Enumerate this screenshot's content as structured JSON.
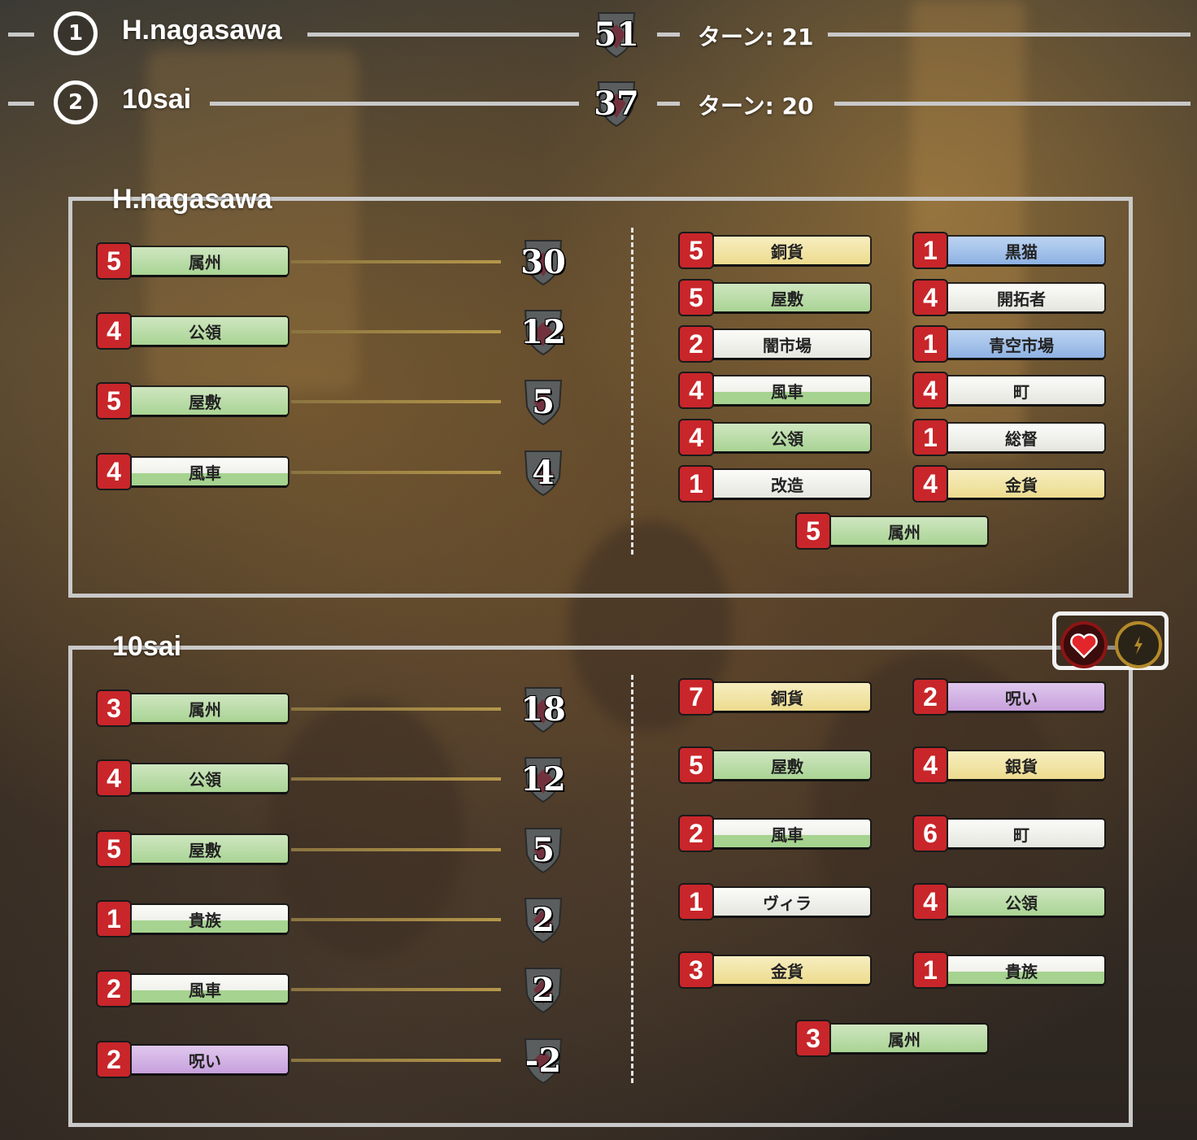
{
  "players": [
    {
      "rank": "1",
      "name": "H.nagasawa",
      "score": "51",
      "turn_label": "ターン: 21"
    },
    {
      "rank": "2",
      "name": "10sai",
      "score": "37",
      "turn_label": "ターン: 20"
    }
  ],
  "panels": [
    {
      "title": "H.nagasawa",
      "scoring": [
        {
          "count": "5",
          "label": "属州",
          "color": "green",
          "points": "30"
        },
        {
          "count": "4",
          "label": "公領",
          "color": "green",
          "points": "12"
        },
        {
          "count": "5",
          "label": "屋敷",
          "color": "green",
          "points": "5"
        },
        {
          "count": "4",
          "label": "風車",
          "color": "white-green",
          "points": "4"
        }
      ],
      "deck": [
        {
          "count": "5",
          "label": "銅貨",
          "color": "yellow"
        },
        {
          "count": "1",
          "label": "黒猫",
          "color": "blue"
        },
        {
          "count": "5",
          "label": "屋敷",
          "color": "green"
        },
        {
          "count": "4",
          "label": "開拓者",
          "color": "white"
        },
        {
          "count": "2",
          "label": "闇市場",
          "color": "white"
        },
        {
          "count": "1",
          "label": "青空市場",
          "color": "blue"
        },
        {
          "count": "4",
          "label": "風車",
          "color": "white-green"
        },
        {
          "count": "4",
          "label": "町",
          "color": "white"
        },
        {
          "count": "4",
          "label": "公領",
          "color": "green"
        },
        {
          "count": "1",
          "label": "総督",
          "color": "white"
        },
        {
          "count": "1",
          "label": "改造",
          "color": "white"
        },
        {
          "count": "4",
          "label": "金貨",
          "color": "yellow"
        },
        {
          "count": "5",
          "label": "属州",
          "color": "green"
        }
      ]
    },
    {
      "title": "10sai",
      "scoring": [
        {
          "count": "3",
          "label": "属州",
          "color": "green",
          "points": "18"
        },
        {
          "count": "4",
          "label": "公領",
          "color": "green",
          "points": "12"
        },
        {
          "count": "5",
          "label": "屋敷",
          "color": "green",
          "points": "5"
        },
        {
          "count": "1",
          "label": "貴族",
          "color": "white-green",
          "points": "2"
        },
        {
          "count": "2",
          "label": "風車",
          "color": "white-green",
          "points": "2"
        },
        {
          "count": "2",
          "label": "呪い",
          "color": "purple",
          "points": "-2"
        }
      ],
      "deck": [
        {
          "count": "7",
          "label": "銅貨",
          "color": "yellow"
        },
        {
          "count": "2",
          "label": "呪い",
          "color": "purple"
        },
        {
          "count": "5",
          "label": "屋敷",
          "color": "green"
        },
        {
          "count": "4",
          "label": "銀貨",
          "color": "yellow"
        },
        {
          "count": "2",
          "label": "風車",
          "color": "white-green"
        },
        {
          "count": "6",
          "label": "町",
          "color": "white"
        },
        {
          "count": "1",
          "label": "ヴィラ",
          "color": "white"
        },
        {
          "count": "4",
          "label": "公領",
          "color": "green"
        },
        {
          "count": "3",
          "label": "金貨",
          "color": "yellow"
        },
        {
          "count": "1",
          "label": "貴族",
          "color": "white-green"
        },
        {
          "count": "3",
          "label": "属州",
          "color": "green"
        }
      ],
      "status_icons": [
        "heart-icon",
        "lightning-icon"
      ]
    }
  ],
  "colors": {
    "number_badge": "#c8262a",
    "frame": "#c9c9c9",
    "gold_line": "#b5974a"
  }
}
